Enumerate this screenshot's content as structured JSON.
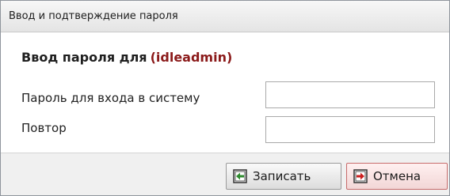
{
  "window": {
    "title": "Ввод и подтверждение пароля"
  },
  "form": {
    "heading_prefix": "Ввод пароля для",
    "username": "(idleadmin)",
    "password_label": "Пароль для входа в систему",
    "password_value": "",
    "repeat_label": "Повтор",
    "repeat_value": ""
  },
  "buttons": {
    "save_label": "Записать",
    "save_icon": "save-icon",
    "cancel_label": "Отмена",
    "cancel_icon": "cancel-icon"
  },
  "colors": {
    "username": "#8b1a1a",
    "save_icon_arrow": "#2e8b2e",
    "cancel_icon_arrow": "#cc1f1f"
  }
}
